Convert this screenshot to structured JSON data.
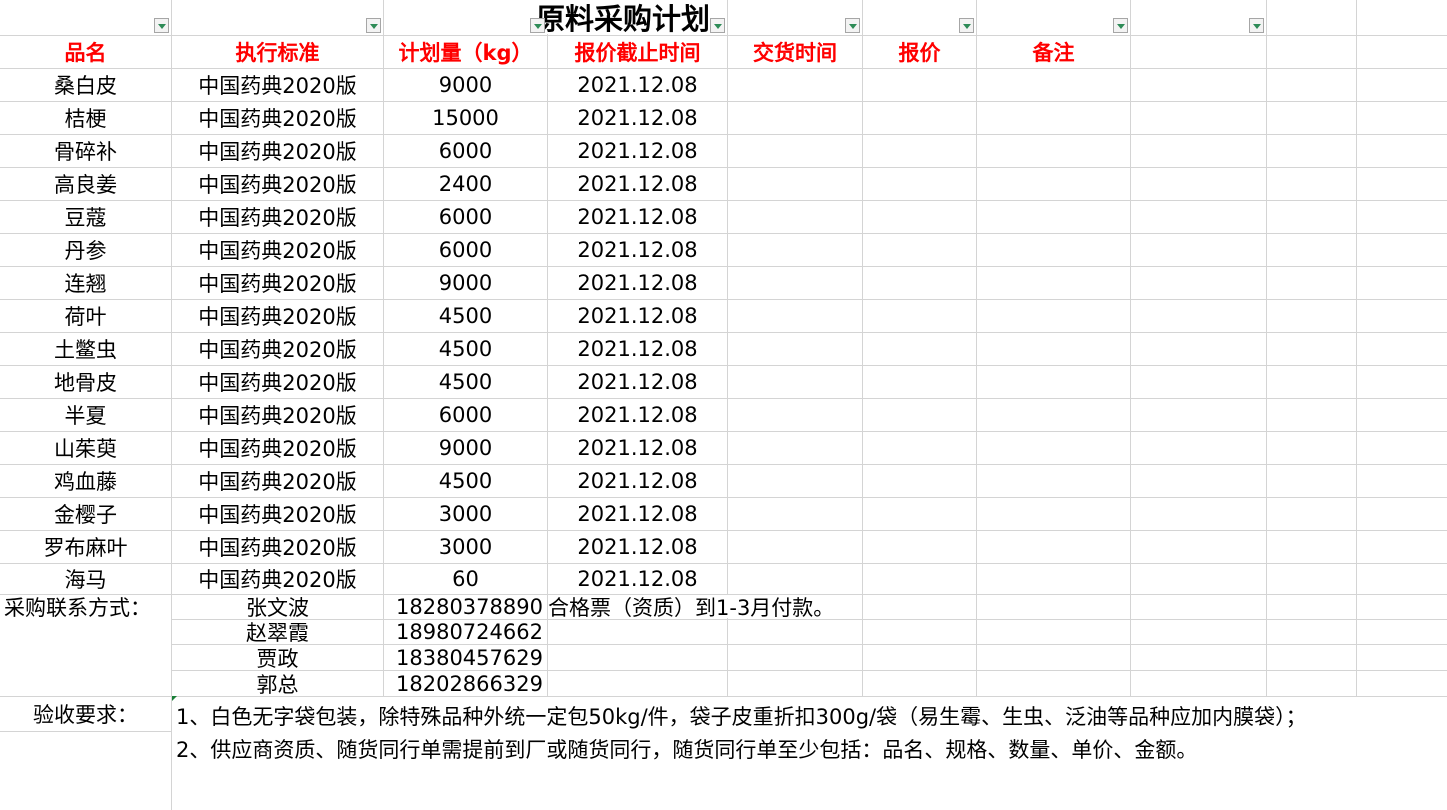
{
  "title": "原料采购计划",
  "headers": [
    "品名",
    "执行标准",
    "计划量（kg）",
    "报价截止时间",
    "交货时间",
    "报价",
    "备注"
  ],
  "rows": [
    [
      "桑白皮",
      "中国药典2020版",
      "9000",
      "2021.12.08"
    ],
    [
      "桔梗",
      "中国药典2020版",
      "15000",
      "2021.12.08"
    ],
    [
      "骨碎补",
      "中国药典2020版",
      "6000",
      "2021.12.08"
    ],
    [
      "高良姜",
      "中国药典2020版",
      "2400",
      "2021.12.08"
    ],
    [
      "豆蔻",
      "中国药典2020版",
      "6000",
      "2021.12.08"
    ],
    [
      "丹参",
      "中国药典2020版",
      "6000",
      "2021.12.08"
    ],
    [
      "连翘",
      "中国药典2020版",
      "9000",
      "2021.12.08"
    ],
    [
      "荷叶",
      "中国药典2020版",
      "4500",
      "2021.12.08"
    ],
    [
      "土鳖虫",
      "中国药典2020版",
      "4500",
      "2021.12.08"
    ],
    [
      "地骨皮",
      "中国药典2020版",
      "4500",
      "2021.12.08"
    ],
    [
      "半夏",
      "中国药典2020版",
      "6000",
      "2021.12.08"
    ],
    [
      "山茱萸",
      "中国药典2020版",
      "9000",
      "2021.12.08"
    ],
    [
      "鸡血藤",
      "中国药典2020版",
      "4500",
      "2021.12.08"
    ],
    [
      "金樱子",
      "中国药典2020版",
      "3000",
      "2021.12.08"
    ],
    [
      "罗布麻叶",
      "中国药典2020版",
      "3000",
      "2021.12.08"
    ],
    [
      "海马",
      "中国药典2020版",
      "60",
      "2021.12.08"
    ]
  ],
  "contact": {
    "label": "采购联系方式：",
    "people": [
      {
        "name": "张文波",
        "phone": "18280378890"
      },
      {
        "name": "赵翠霞",
        "phone": "18980724662"
      },
      {
        "name": "贾政",
        "phone": "18380457629"
      },
      {
        "name": "郭总",
        "phone": "18202866329"
      }
    ],
    "payment_note": "合格票（资质）到1-3月付款。"
  },
  "acceptance": {
    "label": "验收要求：",
    "items": [
      "1、白色无字袋包装，除特殊品种外统一定包50kg/件，袋子皮重折扣300g/袋（易生霉、生虫、泛油等品种应加内膜袋）；",
      "2、供应商资质、随货同行单需提前到厂或随货同行，随货同行单至少包括：品名、规格、数量、单价、金额。"
    ]
  },
  "icons": {
    "filter": "filter-dropdown-icon"
  },
  "colors": {
    "header_text": "#ff0000",
    "grid": "#d4d4d4",
    "filter_arrow": "#2e8b57"
  }
}
